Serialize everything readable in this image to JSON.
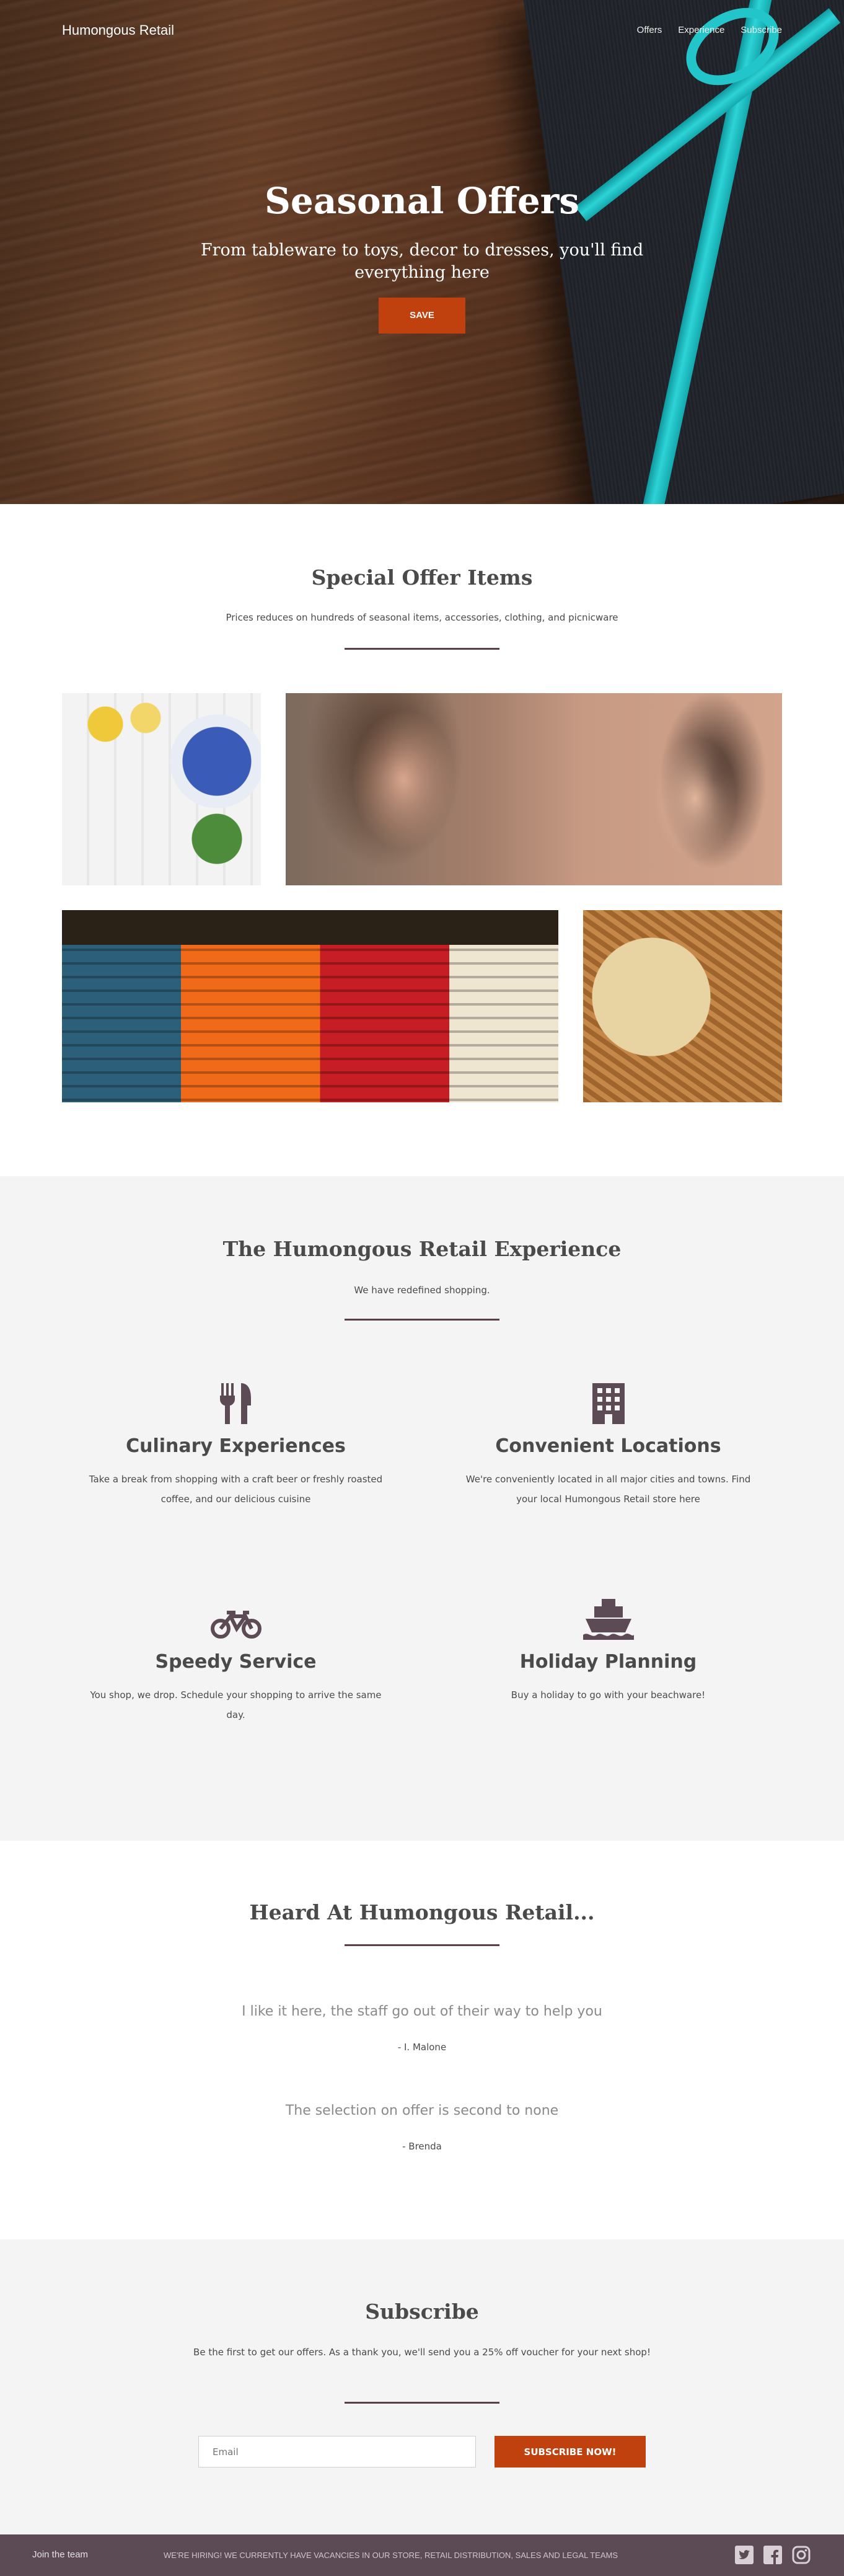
{
  "header": {
    "brand": "Humongous Retail",
    "nav": [
      "Offers",
      "Experience",
      "Subscribe"
    ]
  },
  "hero": {
    "title": "Seasonal Offers",
    "subtitle": "From tableware to toys, decor to dresses, you'll find everything here",
    "button": "SAVE"
  },
  "offers": {
    "title": "Special Offer Items",
    "subtitle": "Prices reduces on hundreds of seasonal items, accessories, clothing, and picnicware",
    "images": [
      "tea-and-lemons-photo",
      "woman-portrait-photo",
      "folded-shirts-photo",
      "straw-hat-basket-photo"
    ]
  },
  "experience": {
    "title": "The Humongous Retail Experience",
    "subtitle": "We have redefined shopping.",
    "features": [
      {
        "icon": "cutlery-icon",
        "title": "Culinary Experiences",
        "text": "Take a break from shopping with a craft beer or freshly roasted coffee, and our delicious cuisine"
      },
      {
        "icon": "building-icon",
        "title": "Convenient Locations",
        "text": "We're conveniently located in all major cities and towns. Find your local Humongous Retail store here"
      },
      {
        "icon": "bicycle-icon",
        "title": "Speedy Service",
        "text": "You shop, we drop. Schedule your shopping to arrive the same day."
      },
      {
        "icon": "ship-icon",
        "title": "Holiday Planning",
        "text": "Buy a holiday to go with your beachware!"
      }
    ]
  },
  "testimonials": {
    "title": "Heard At Humongous Retail...",
    "items": [
      {
        "quote": "I like it here, the staff go out of their way to help you",
        "author": "- I. Malone"
      },
      {
        "quote": "The selection on offer is second to none",
        "author": "- Brenda"
      }
    ]
  },
  "subscribe": {
    "title": "Subscribe",
    "subtitle": "Be the first to get our offers. As a thank you, we'll send you a 25% off voucher for your next shop!",
    "email_placeholder": "Email",
    "button": "SUBSCRIBE NOW!"
  },
  "footer": {
    "join": "Join the team",
    "hiring": "WE'RE HIRING! WE CURRENTLY HAVE VACANCIES IN OUR STORE, RETAIL DISTRIBUTION, SALES AND LEGAL TEAMS",
    "social": [
      "twitter-icon",
      "facebook-icon",
      "instagram-icon"
    ]
  },
  "colors": {
    "accent": "#c0400e",
    "footer_bg": "#5c4a55",
    "divider": "#5a4046",
    "section_bg": "#f4f4f4"
  }
}
